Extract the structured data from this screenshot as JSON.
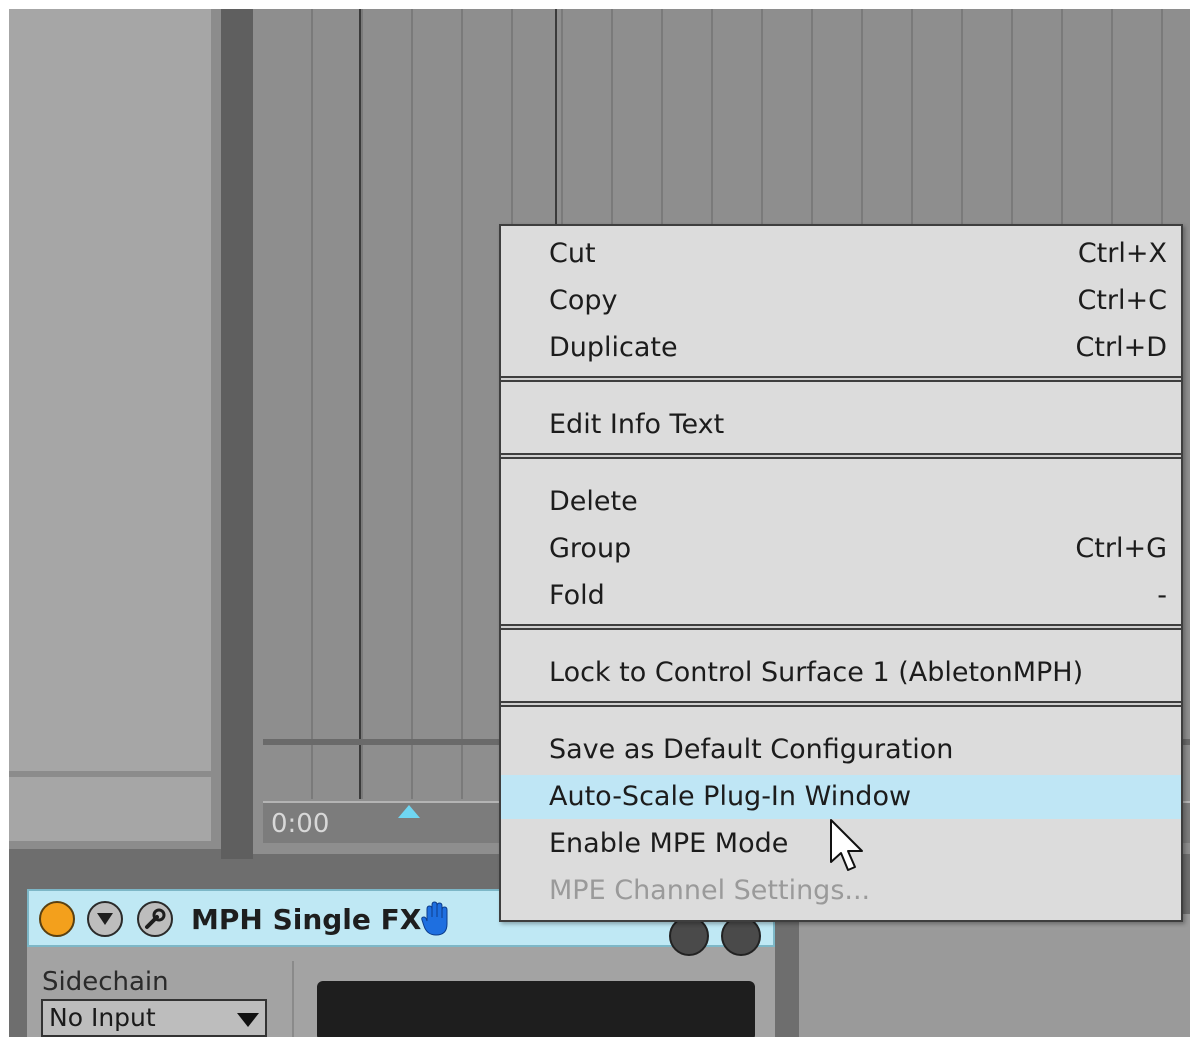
{
  "device": {
    "name": "MPH Single FX",
    "sidechain_label": "Sidechain",
    "input_value": "No Input",
    "power_color": "#f3a01c"
  },
  "timeline": {
    "timecode": "0:00",
    "marker_color": "#6fd6f2"
  },
  "context_menu": {
    "highlight_color": "#bfe6f5",
    "groups": [
      [
        {
          "label": "Cut",
          "shortcut": "Ctrl+X"
        },
        {
          "label": "Copy",
          "shortcut": "Ctrl+C"
        },
        {
          "label": "Duplicate",
          "shortcut": "Ctrl+D"
        }
      ],
      [
        {
          "label": "Edit Info Text",
          "shortcut": ""
        }
      ],
      [
        {
          "label": "Delete",
          "shortcut": ""
        },
        {
          "label": "Group",
          "shortcut": "Ctrl+G"
        },
        {
          "label": "Fold",
          "shortcut": "-"
        }
      ],
      [
        {
          "label": "Lock to Control Surface 1 (AbletonMPH)",
          "shortcut": ""
        }
      ],
      [
        {
          "label": "Save as Default Configuration",
          "shortcut": ""
        },
        {
          "label": "Auto-Scale Plug-In Window",
          "shortcut": "",
          "state": "highlighted"
        },
        {
          "label": "Enable MPE Mode",
          "shortcut": ""
        },
        {
          "label": "MPE Channel Settings...",
          "shortcut": "",
          "state": "disabled"
        }
      ]
    ]
  },
  "icons": {
    "power": "power-button-icon",
    "fold": "fold-triangle-icon",
    "edit": "wrench-icon",
    "hand": "hand-icon",
    "cursor": "mouse-pointer-icon"
  }
}
